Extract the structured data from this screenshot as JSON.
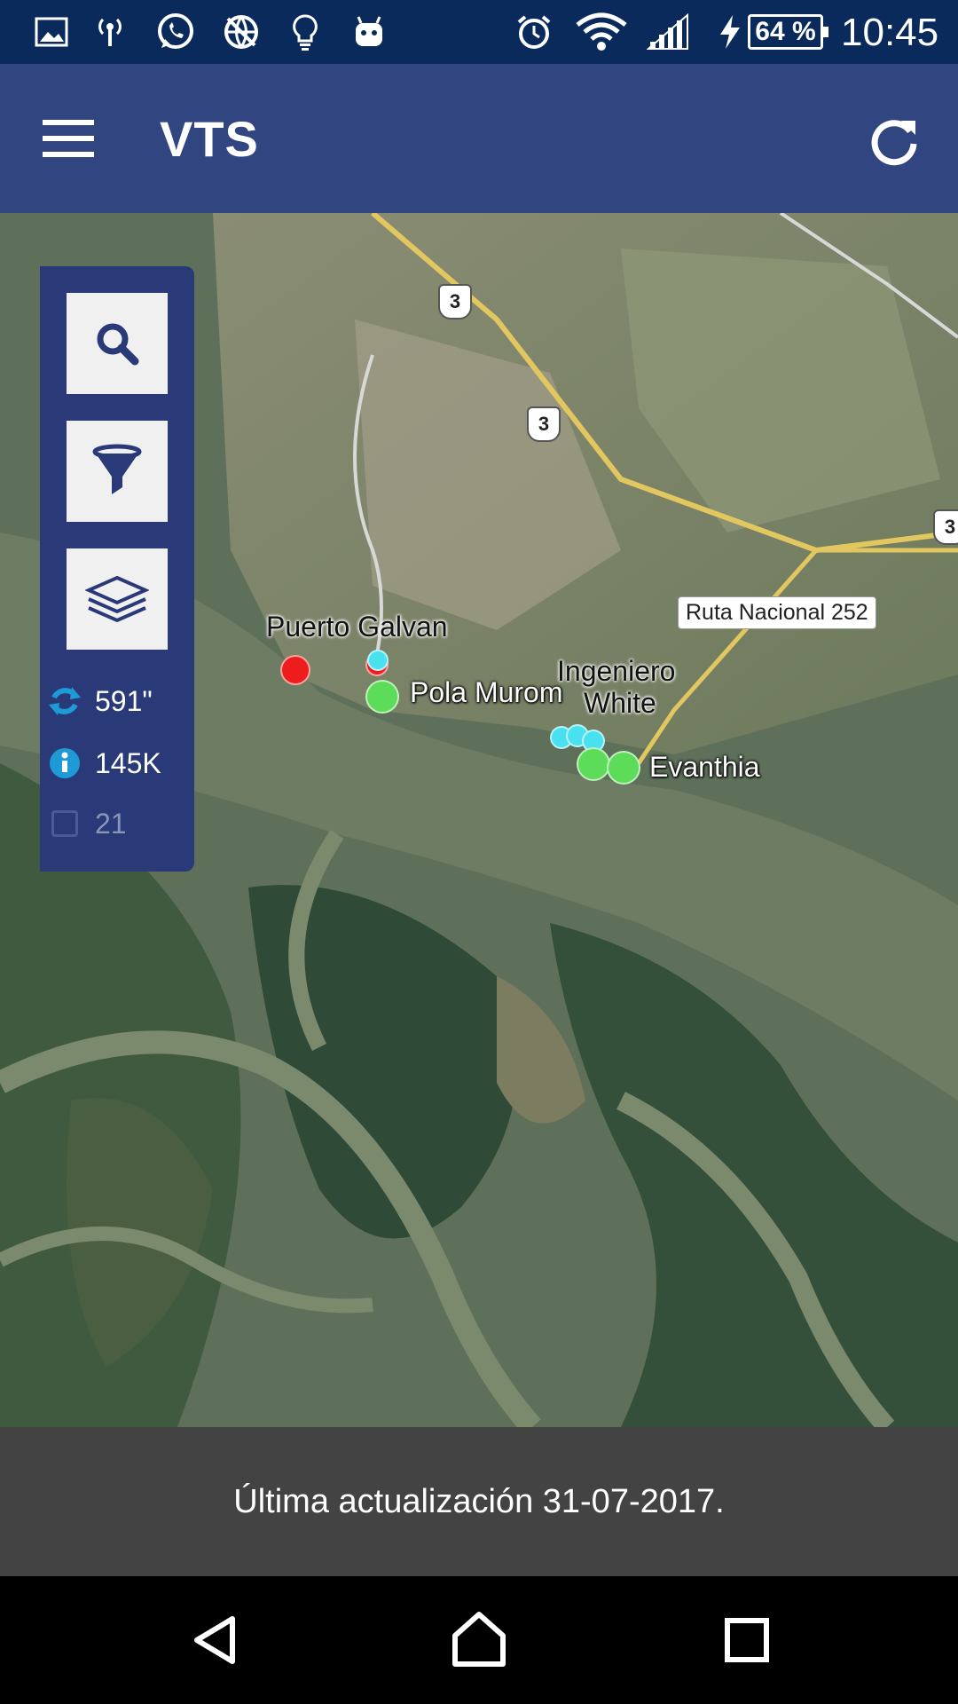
{
  "status_bar": {
    "battery": "64 %",
    "time": "10:45",
    "icons": [
      "image-icon",
      "hotspot-icon",
      "whatsapp-icon",
      "no-web-icon",
      "lightbulb-icon",
      "android-icon",
      "alarm-icon",
      "wifi-icon",
      "signal-icon",
      "charging-icon"
    ]
  },
  "app_bar": {
    "title": "VTS",
    "menu_icon": "hamburger-menu-icon",
    "refresh_icon": "refresh-icon"
  },
  "side_panel": {
    "tools": [
      "search-icon",
      "filter-icon",
      "layers-icon"
    ],
    "stats": {
      "refresh_seconds": "591\"",
      "info_count": "145K",
      "checkbox_count": "21"
    }
  },
  "map": {
    "place_labels": {
      "puerto_galvan": "Puerto Galvan",
      "ingeniero": "Ingeniero",
      "white": "White",
      "ruta_252": "Ruta Nacional 252"
    },
    "vessel_labels": {
      "pola_murom": "Pola Murom",
      "evanthia": "Evanthia"
    },
    "route_shields": [
      "3",
      "3",
      "3"
    ],
    "marker_colors": {
      "red": "#ee1c1c",
      "green": "#5ddc5a",
      "cyan": "#49e1f0"
    }
  },
  "footer": {
    "last_update": "Última actualización 31-07-2017."
  },
  "nav_bar": {
    "icons": [
      "back-icon",
      "home-icon",
      "recents-icon"
    ]
  },
  "colors": {
    "status_bar": "#0a2a5c",
    "app_bar": "#314581",
    "side_panel": "#2a3a78",
    "footer": "#434343",
    "accent_icon": "#1e9ad6"
  }
}
